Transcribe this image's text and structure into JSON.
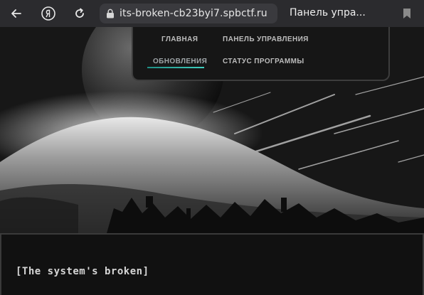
{
  "browser": {
    "url": "its-broken-cb23byi7.spbctf.ru",
    "tab_title": "Панель упра..."
  },
  "nav": {
    "items": [
      {
        "label": "ГЛАВНАЯ"
      },
      {
        "label": "ПАНЕЛЬ УПРАВЛЕНИЯ"
      },
      {
        "label": "ОБНОВЛЕНИЯ"
      },
      {
        "label": "СТАТУС ПРОГРАММЫ"
      }
    ],
    "active_index": 2,
    "accent_color": "#3fd0c0"
  },
  "content": {
    "status_text": "[The system's broken]"
  },
  "icons": {
    "back": "arrow-left-icon",
    "yandex": "yandex-logo-icon",
    "reload": "reload-icon",
    "lock": "lock-icon",
    "bookmark": "bookmark-icon"
  }
}
